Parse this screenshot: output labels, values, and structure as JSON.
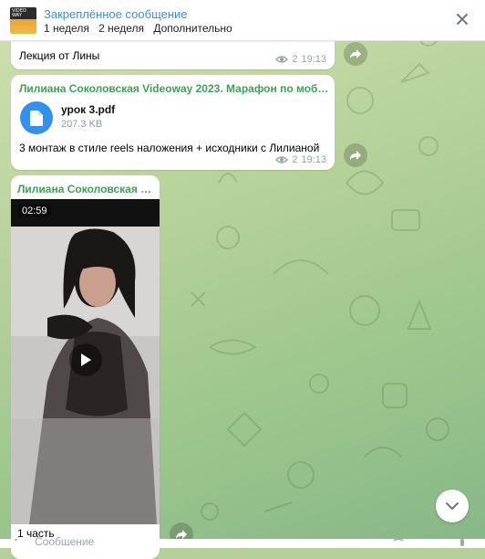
{
  "pinned": {
    "title": "Закреплённое сообщение",
    "tags": [
      "1 неделя",
      "2 неделя",
      "Дополнительно"
    ],
    "thumb_text": "VIDEO WAY"
  },
  "messages": [
    {
      "caption": "Лекция от Лины",
      "views": "2",
      "time": "19:13"
    },
    {
      "sender": "Лилиана Соколовская Videoway 2023. Марафон по мобильно...",
      "file_name": "урок 3.pdf",
      "file_size": "207.3 KB",
      "caption": "3 монтаж в стиле reels наложения + исходники с Лилианой",
      "views": "2",
      "time": "19:13"
    },
    {
      "sender": "Лилиана Соколовская Vi...",
      "video_duration": "02:59",
      "caption": "1 часть"
    }
  ],
  "composer": {
    "placeholder": "Сообщение"
  },
  "colors": {
    "accent": "#3390ec",
    "sender": "#3da253",
    "chat_bg": "#b7cf9a"
  }
}
